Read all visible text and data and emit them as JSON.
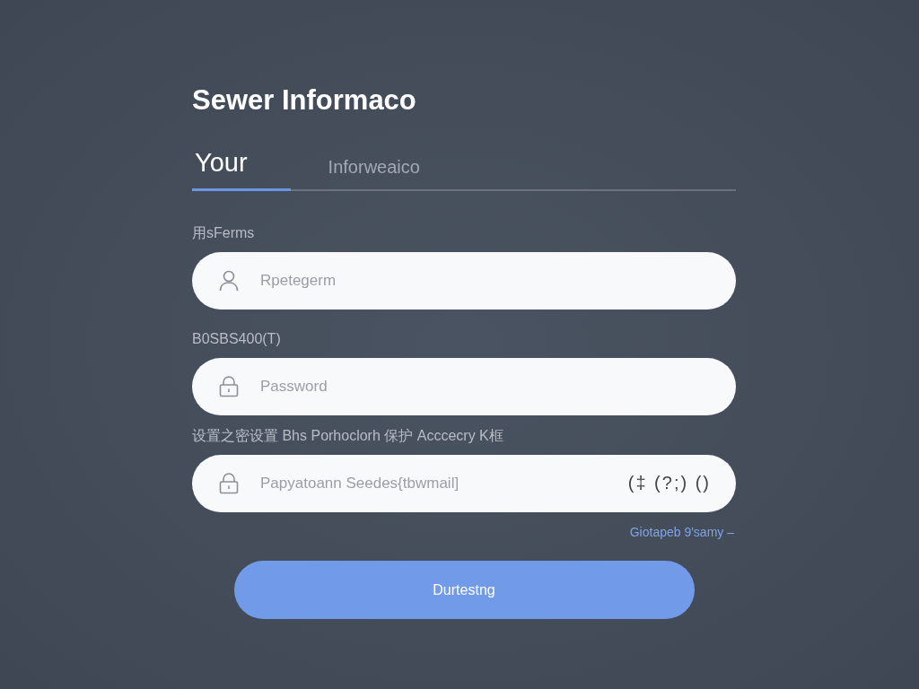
{
  "title": "Sewer Informaco",
  "tabs": [
    {
      "label": "Your",
      "selected": true
    },
    {
      "label": "Inforweaico",
      "selected": false
    }
  ],
  "fields": [
    {
      "label": "用sFerms",
      "placeholder": "Rpetegerm",
      "kind": "user"
    },
    {
      "label": "B0SBS400(T)",
      "placeholder": "Password",
      "kind": "secret"
    },
    {
      "label": "设置之密设置 Bhs Porhoclorh 保护 Acccecry K框",
      "placeholder": "Papyatoann Seedes{tbwmail]",
      "kind": "lock",
      "suffix": "(‡ (?;) ()"
    }
  ],
  "link": "Giotapeb 9'samy –",
  "button": "Durtestng"
}
